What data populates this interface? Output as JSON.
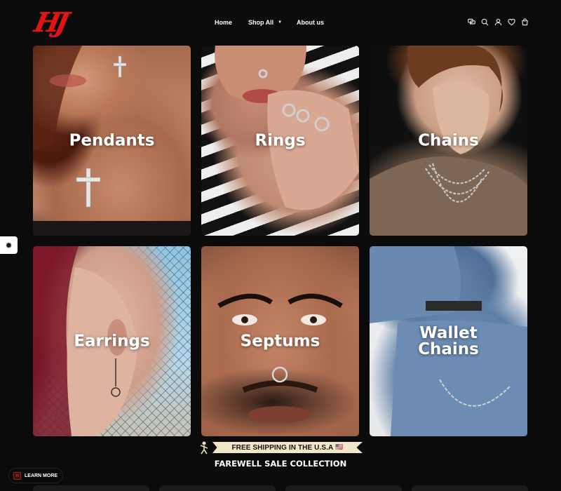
{
  "header": {
    "logo_text": "HJ",
    "nav": [
      {
        "label": "Home"
      },
      {
        "label": "Shop All"
      },
      {
        "label": "About us"
      }
    ],
    "icons": [
      "chat-icon",
      "search-icon",
      "account-icon",
      "wishlist-icon",
      "cart-icon"
    ]
  },
  "categories": [
    {
      "label": "Pendants"
    },
    {
      "label": "Rings"
    },
    {
      "label": "Chains"
    },
    {
      "label": "Earrings"
    },
    {
      "label": "Septums"
    },
    {
      "label": "Wallet\nChains"
    }
  ],
  "side_button": {
    "icon": "sparkle-icon"
  },
  "banner": {
    "shipping_text": "FREE SHIPPING IN THE U.S.A",
    "flag": "🇺🇸"
  },
  "section": {
    "title": "FAREWELL SALE COLLECTION"
  },
  "learn_more": {
    "label": "LEARN MORE"
  },
  "colors": {
    "background": "#0b0b0b",
    "brand_red": "#e01414",
    "ribbon": "#f1e6c8"
  }
}
